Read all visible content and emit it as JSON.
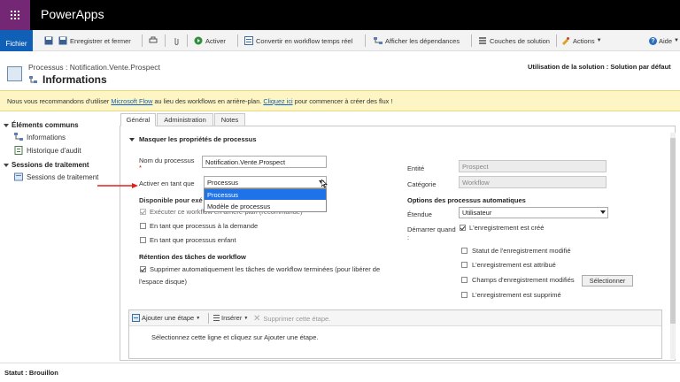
{
  "app": {
    "name": "PowerApps"
  },
  "ribbon": {
    "file": "Fichier",
    "save_close": "Enregistrer et fermer",
    "activate": "Activer",
    "convert": "Convertir en workflow temps réel",
    "dependencies": "Afficher les dépendances",
    "layers": "Couches de solution",
    "actions": "Actions",
    "help": "Aide"
  },
  "header": {
    "subtitle": "Processus : Notification.Vente.Prospect",
    "title": "Informations",
    "solution": "Utilisation de la solution : Solution par défaut"
  },
  "notice": {
    "before": "Nous vous recommandons d'utiliser ",
    "link1": "Microsoft Flow",
    "middle": " au lieu des workflows en arrière-plan. ",
    "link2": "Cliquez ici",
    "after": " pour commencer à créer des flux !"
  },
  "nav": {
    "common": "Éléments communs",
    "informations": "Informations",
    "audit": "Historique d'audit",
    "sessions": "Sessions de traitement",
    "session_item": "Sessions de traitement"
  },
  "tabs": {
    "general": "Général",
    "admin": "Administration",
    "notes": "Notes"
  },
  "form": {
    "section": "Masquer les propriétés de processus",
    "name_label": "Nom du processus",
    "name_value": "Notification.Vente.Prospect",
    "activate_as_label": "Activer en tant que",
    "activate_as_value": "Processus",
    "options": [
      "Processus",
      "Modèle de processus"
    ],
    "available_label": "Disponible pour exé",
    "run_bg": "Exécuter ce workflow en arrière-plan (recommandé)",
    "on_demand": "En tant que processus à la demande",
    "child": "En tant que processus enfant",
    "retention_title": "Rétention des tâches de workflow",
    "delete_auto": "Supprimer automatiquement les tâches de workflow terminées (pour libérer de",
    "delete_auto_2": "l'espace disque)",
    "entity_label": "Entité",
    "entity_value": "Prospect",
    "category_label": "Catégorie",
    "category_value": "Workflow",
    "auto_title": "Options des processus automatiques",
    "scope_label": "Étendue",
    "scope_value": "Utilisateur",
    "start_label": "Démarrer quand",
    "start_colon": ":",
    "created": "L'enregistrement est créé",
    "status_changed": "Statut de l'enregistrement modifié",
    "assigned": "L'enregistrement est attribué",
    "fields_changed": "Champs d'enregistrement modifiés",
    "select_btn": "Sélectionner",
    "deleted": "L'enregistrement est supprimé"
  },
  "steps": {
    "add": "Ajouter une étape",
    "insert": "Insérer",
    "delete": "Supprimer cette étape.",
    "hint": "Sélectionnez cette ligne et cliquez sur Ajouter une étape."
  },
  "status": {
    "text": "Statut : Brouillon"
  }
}
